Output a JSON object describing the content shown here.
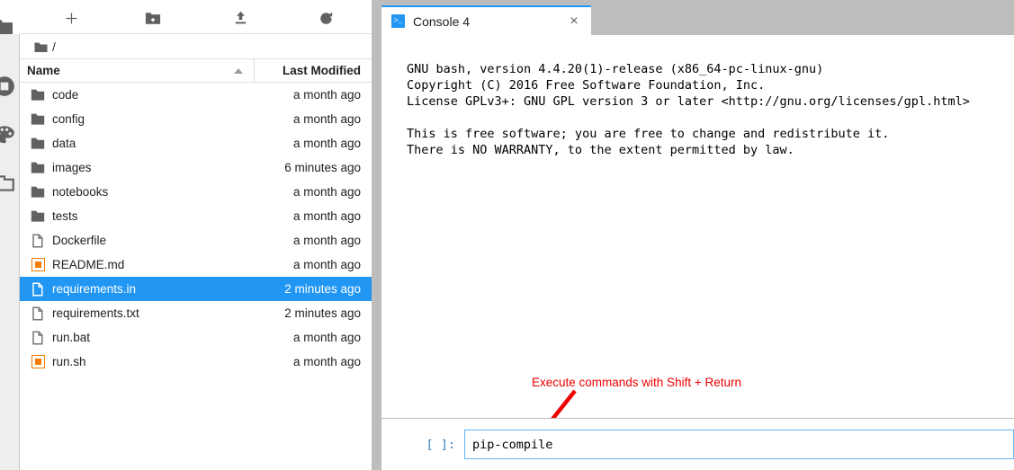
{
  "activity_bar": {
    "items": [
      {
        "name": "running-terminals-icon",
        "glyph": "running"
      },
      {
        "name": "palette-icon",
        "glyph": "palette"
      },
      {
        "name": "tabs-icon",
        "glyph": "tabs"
      }
    ]
  },
  "file_browser": {
    "toolbar": [
      {
        "name": "new-launcher-button",
        "icon": "plus-icon",
        "title": "New Launcher"
      },
      {
        "name": "new-folder-button",
        "icon": "new-folder-icon",
        "title": "New Folder"
      },
      {
        "name": "upload-button",
        "icon": "upload-icon",
        "title": "Upload Files"
      },
      {
        "name": "refresh-button",
        "icon": "refresh-icon",
        "title": "Refresh File List"
      }
    ],
    "breadcrumb": {
      "home_icon": "folder-icon",
      "path": "/"
    },
    "columns": {
      "name": "Name",
      "last_modified": "Last Modified",
      "sort_direction": "ascending"
    },
    "rows": [
      {
        "name": "code",
        "type": "folder",
        "modified": "a month ago",
        "selected": false
      },
      {
        "name": "config",
        "type": "folder",
        "modified": "a month ago",
        "selected": false
      },
      {
        "name": "data",
        "type": "folder",
        "modified": "a month ago",
        "selected": false
      },
      {
        "name": "images",
        "type": "folder",
        "modified": "6 minutes ago",
        "selected": false
      },
      {
        "name": "notebooks",
        "type": "folder",
        "modified": "a month ago",
        "selected": false
      },
      {
        "name": "tests",
        "type": "folder",
        "modified": "a month ago",
        "selected": false
      },
      {
        "name": "Dockerfile",
        "type": "file",
        "modified": "a month ago",
        "selected": false
      },
      {
        "name": "README.md",
        "type": "marked",
        "modified": "a month ago",
        "selected": false
      },
      {
        "name": "requirements.in",
        "type": "file",
        "modified": "2 minutes ago",
        "selected": true
      },
      {
        "name": "requirements.txt",
        "type": "file",
        "modified": "2 minutes ago",
        "selected": false
      },
      {
        "name": "run.bat",
        "type": "file",
        "modified": "a month ago",
        "selected": false
      },
      {
        "name": "run.sh",
        "type": "marked",
        "modified": "a month ago",
        "selected": false
      }
    ]
  },
  "console": {
    "tab": {
      "label": "Console 4",
      "icon": ">_",
      "close_label": "×"
    },
    "output": "GNU bash, version 4.4.20(1)-release (x86_64-pc-linux-gnu)\nCopyright (C) 2016 Free Software Foundation, Inc.\nLicense GPLv3+: GNU GPL version 3 or later <http://gnu.org/licenses/gpl.html>\n\nThis is free software; you are free to change and redistribute it.\nThere is NO WARRANTY, to the extent permitted by law.",
    "prompt": {
      "label": "[ ]:",
      "value": "pip-compile",
      "placeholder": ""
    },
    "annotation": {
      "text": "Execute commands with Shift + Return",
      "color": "#ee0000"
    }
  },
  "colors": {
    "selection_blue": "#2196f3",
    "tab_accent": "#2196f3",
    "annotation_red": "#ee0000",
    "marked_orange": "#f57c00",
    "splitter_gray": "#bdbdbd",
    "prompt_blue": "#307fc1"
  }
}
